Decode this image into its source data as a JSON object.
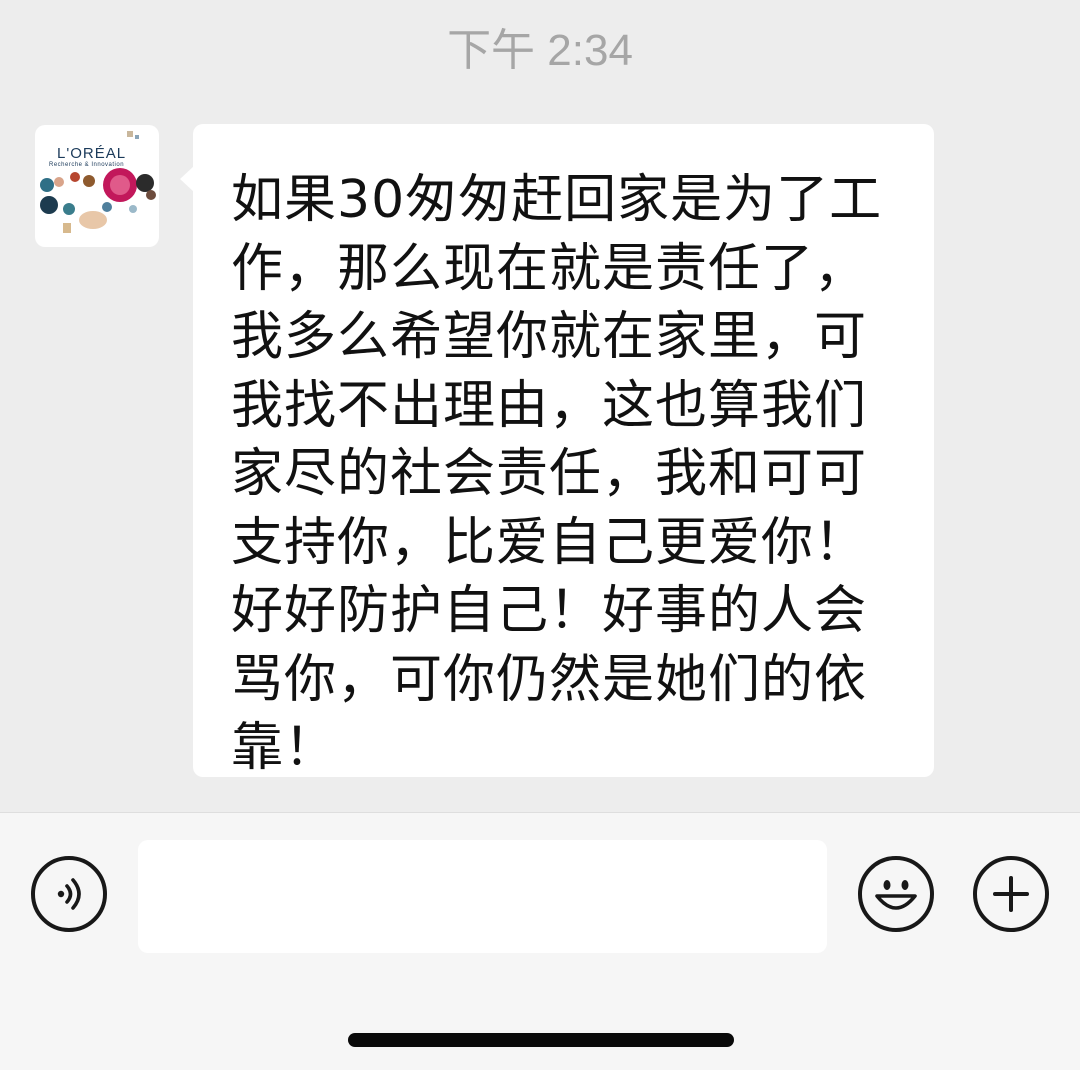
{
  "status": {
    "time": "下午 2:34"
  },
  "contact": {
    "avatar_brand": "L'ORÉAL",
    "avatar_subtitle": "Recherche & Innovation",
    "avatar_icon": "loreal-logo"
  },
  "message": {
    "text": "如果30匆匆赶回家是为了工作，那么现在就是责任了，我多么希望你就在家里，可我找不出理由，这也算我们家尽的社会责任，我和可可支持你，比爱自己更爱你！好好防护自己！好事的人会骂你，可你仍然是她们的依靠！"
  },
  "input_bar": {
    "voice_icon": "voice-icon",
    "text_value": "",
    "emoji_icon": "emoji-icon",
    "plus_icon": "plus-icon"
  },
  "colors": {
    "background": "#ededed",
    "bubble": "#ffffff",
    "timestamp": "#a6a6a6",
    "input_bar": "#f6f6f6"
  }
}
